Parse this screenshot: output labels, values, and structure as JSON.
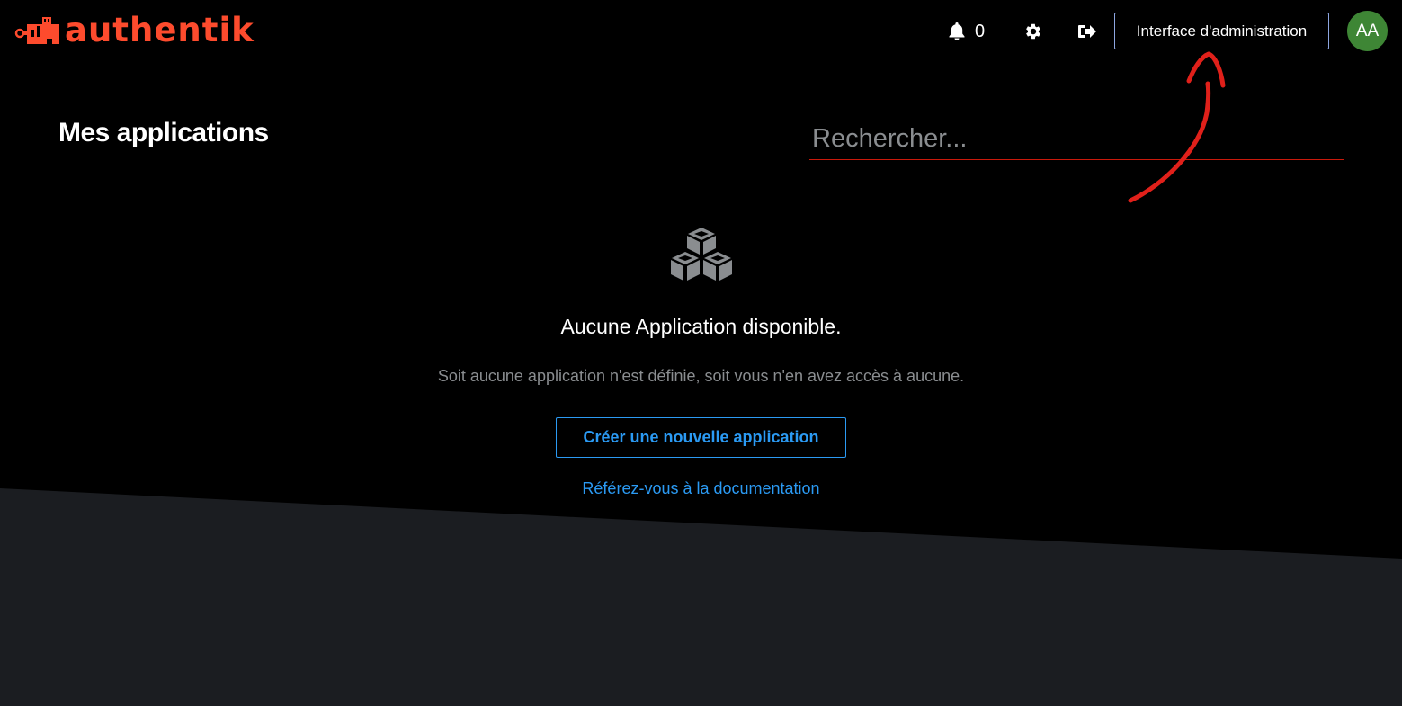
{
  "header": {
    "brand": "authentik",
    "notification_count": "0",
    "admin_button_label": "Interface d'administration",
    "avatar_initials": "AA"
  },
  "main": {
    "title": "Mes applications",
    "search_placeholder": "Rechercher..."
  },
  "empty_state": {
    "title": "Aucune Application disponible.",
    "body": "Soit aucune application n'est définie, soit vous n'en avez accès à aucune.",
    "create_button": "Créer une nouvelle application",
    "doc_link": "Référez-vous à la documentation"
  },
  "colors": {
    "brand": "#fd4b2d",
    "accent": "#2b9af3",
    "avatar": "#3e8635",
    "annotation": "#e0201a"
  },
  "icons": [
    "bell-icon",
    "gear-icon",
    "logout-icon",
    "cubes-icon",
    "brand-logo-icon"
  ]
}
